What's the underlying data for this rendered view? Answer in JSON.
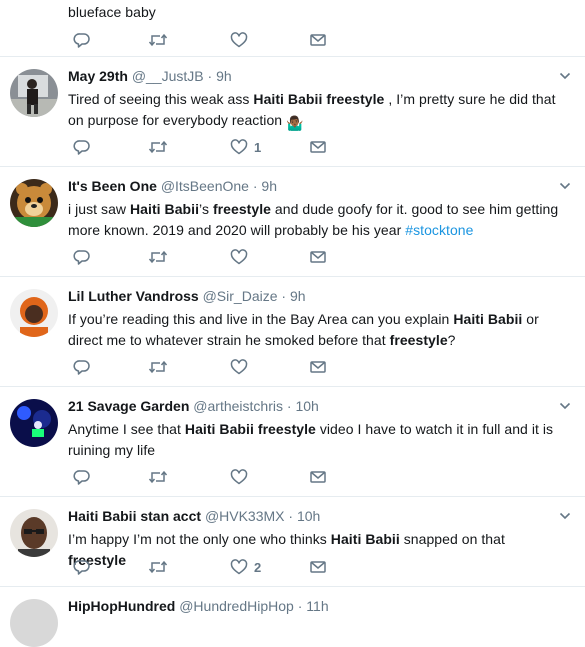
{
  "tweets": [
    {
      "name": "",
      "handle": "",
      "time": "",
      "segments": [
        {
          "t": "blueface baby"
        }
      ],
      "like_count": "",
      "avatar": "none"
    },
    {
      "name": "May 29th",
      "handle": "@__JustJB",
      "time": "9h",
      "segments": [
        {
          "t": "Tired of seeing this weak ass "
        },
        {
          "t": "Haiti Babii freestyle",
          "b": true
        },
        {
          "t": " , I’m pretty sure he did that on purpose for everybody reaction "
        },
        {
          "t": "🤷🏾‍♂️",
          "emoji": true
        }
      ],
      "like_count": "1",
      "avatar": "person-dark"
    },
    {
      "name": "It's Been One",
      "handle": "@ItsBeenOne",
      "time": "9h",
      "segments": [
        {
          "t": "i just saw "
        },
        {
          "t": "Haiti Babii",
          "b": true
        },
        {
          "t": "’s "
        },
        {
          "t": "freestyle",
          "b": true
        },
        {
          "t": " and dude goofy for it. good to see him getting more known. 2019 and 2020 will probably be his year "
        },
        {
          "t": "#stocktone",
          "tag": true
        }
      ],
      "like_count": "",
      "avatar": "cartoon-bear"
    },
    {
      "name": "Lil Luther Vandross",
      "handle": "@Sir_Daize",
      "time": "9h",
      "segments": [
        {
          "t": "If you’re reading this and live in the Bay Area can you explain "
        },
        {
          "t": "Haiti Babii",
          "b": true
        },
        {
          "t": " or direct me to whatever strain he smoked before that "
        },
        {
          "t": "freestyle",
          "b": true
        },
        {
          "t": "?"
        }
      ],
      "like_count": "",
      "avatar": "person-orange"
    },
    {
      "name": "21 Savage Garden",
      "handle": "@artheistchris",
      "time": "10h",
      "segments": [
        {
          "t": "Anytime I see that "
        },
        {
          "t": "Haiti Babii freestyle",
          "b": true
        },
        {
          "t": " video I have to watch it in full and it is ruining my life"
        }
      ],
      "like_count": "",
      "avatar": "night-blue"
    },
    {
      "name": "Haiti Babii stan acct",
      "handle": "@HVK33MX",
      "time": "10h",
      "segments": [
        {
          "t": "I’m happy I’m not the only one who thinks "
        },
        {
          "t": "Haiti Babii",
          "b": true
        },
        {
          "t": " snapped on that "
        },
        {
          "t": "freestyle",
          "b": true
        }
      ],
      "like_count": "2",
      "avatar": "person-glasses"
    },
    {
      "name": "HipHopHundred",
      "handle": "@HundredHipHop",
      "time": "11h",
      "segments": [],
      "like_count": "",
      "avatar": "partial"
    }
  ],
  "icons": {
    "reply": "reply-icon",
    "retweet": "retweet-icon",
    "like": "heart-icon",
    "message": "envelope-icon",
    "caret": "chevron-down-icon"
  },
  "colors": {
    "text": "#14171a",
    "secondary": "#657786",
    "hashtag": "#1b95e0",
    "divider": "#e6ecf0"
  }
}
